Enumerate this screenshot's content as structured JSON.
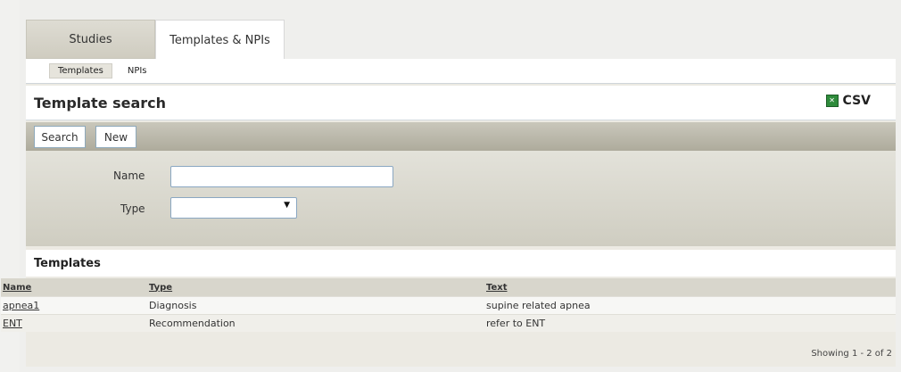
{
  "top_tabs": [
    {
      "label": "Studies"
    },
    {
      "label": "Templates & NPIs"
    }
  ],
  "sub_tabs": [
    {
      "label": "Templates"
    },
    {
      "label": "NPIs"
    }
  ],
  "page_title": "Template search",
  "export": {
    "label": "CSV",
    "icon": "excel-icon"
  },
  "toolbar": {
    "search_label": "Search",
    "new_label": "New"
  },
  "form": {
    "name_label": "Name",
    "name_value": "",
    "type_label": "Type",
    "type_value": ""
  },
  "results": {
    "title": "Templates",
    "columns": [
      "Name",
      "Type",
      "Text"
    ],
    "rows": [
      {
        "name": "apnea1",
        "type": "Diagnosis",
        "text": "supine related apnea"
      },
      {
        "name": "ENT",
        "type": "Recommendation",
        "text": "refer to ENT"
      }
    ],
    "paging": "Showing 1 - 2 of 2"
  },
  "colors": {
    "toolbar": "#aeab9c",
    "input_border": "#8aa7c2",
    "export_icon": "#2e8b3b"
  }
}
